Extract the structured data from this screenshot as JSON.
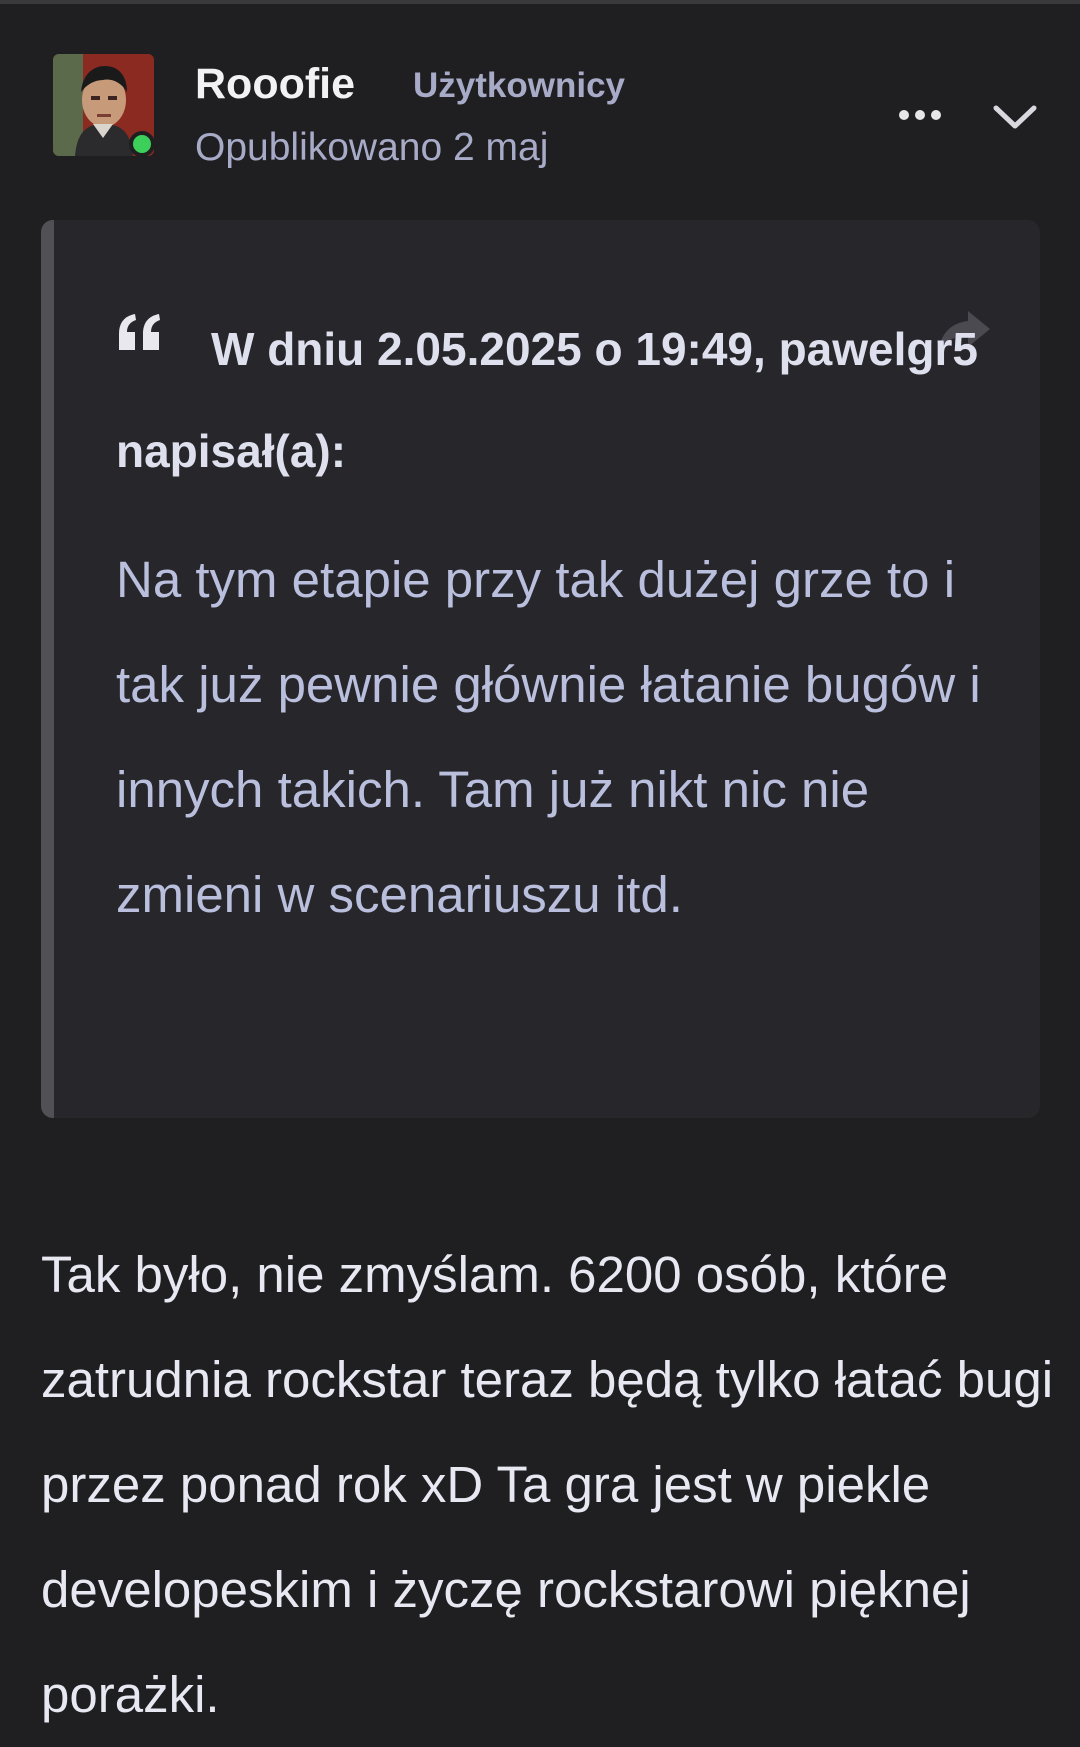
{
  "post": {
    "author": {
      "name": "Rooofie",
      "group": "Użytkownicy",
      "online": true,
      "avatar_icon": "user-avatar"
    },
    "date": "Opublikowano 2 maj",
    "actions": {
      "more_icon": "more-horizontal-icon",
      "collapse_icon": "chevron-down-icon"
    },
    "quote": {
      "citation": "W dniu 2.05.2025 o 19:49, pawelgr5 napisał(a):",
      "text": "Na tym etapie przy tak dużej grze to i tak już pewnie głównie łatanie bugów i innych takich. Tam już nikt nic nie zmieni w scenariuszu itd.",
      "quote_icon": "quote-icon",
      "share_icon": "share-icon"
    },
    "content": "Tak było, nie zmyślam. 6200 osób, które zatrudnia rockstar teraz będą tylko łatać bugi przez ponad rok xD Ta gra jest w piekle developeskim i życzę rockstarowi pięknej porażki."
  },
  "colors": {
    "background": "#1f1f21",
    "quote_background": "#26262b",
    "quote_bar": "#505055",
    "online": "#3ccf5a",
    "muted_text": "#a8abc8"
  }
}
